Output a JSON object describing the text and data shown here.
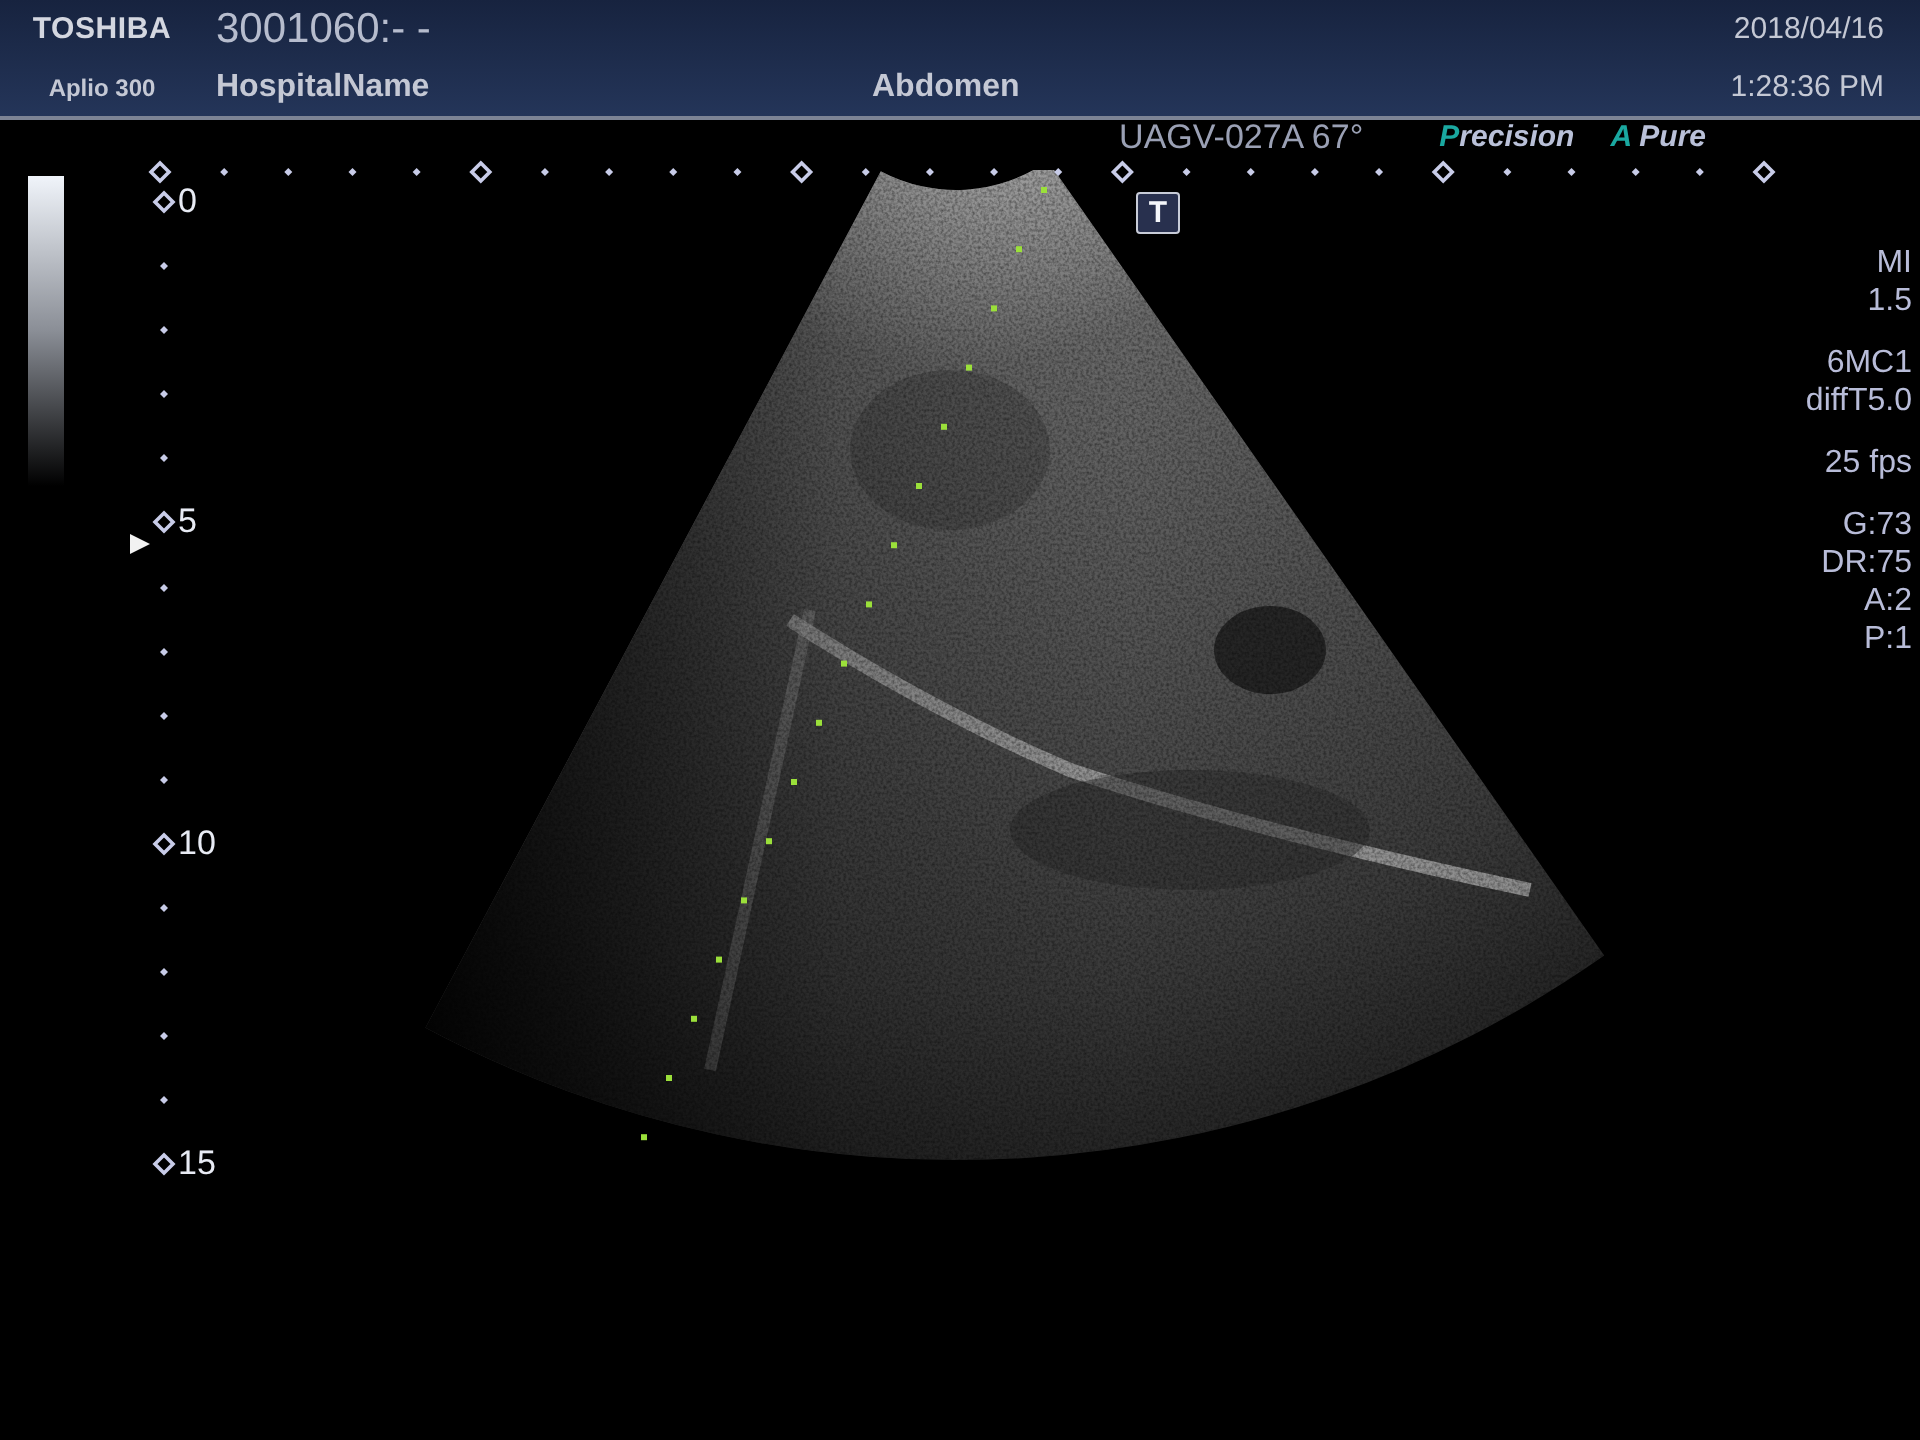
{
  "header": {
    "brand": "TOSHIBA",
    "model": "Aplio 300",
    "patient_id": "3001060:- -",
    "hospital": "HospitalName",
    "exam": "Abdomen",
    "date": "2018/04/16",
    "time": "1:28:36 PM"
  },
  "probe_info": {
    "probe": "UAGV-027A 67°",
    "precision": "Precision",
    "apure": "A Pure",
    "transducer_mark": "T"
  },
  "depth_ticks": [
    {
      "kind": "major",
      "label": "0",
      "focus": false
    },
    {
      "kind": "minor",
      "focus": false
    },
    {
      "kind": "minor",
      "focus": false
    },
    {
      "kind": "minor",
      "focus": false
    },
    {
      "kind": "minor",
      "focus": false
    },
    {
      "kind": "major",
      "label": "5",
      "focus": true
    },
    {
      "kind": "minor",
      "focus": false
    },
    {
      "kind": "minor",
      "focus": false
    },
    {
      "kind": "minor",
      "focus": false
    },
    {
      "kind": "minor",
      "focus": false
    },
    {
      "kind": "major",
      "label": "10",
      "focus": false
    },
    {
      "kind": "minor",
      "focus": false
    },
    {
      "kind": "minor",
      "focus": false
    },
    {
      "kind": "minor",
      "focus": false
    },
    {
      "kind": "minor",
      "focus": false
    },
    {
      "kind": "major",
      "label": "15",
      "focus": false
    }
  ],
  "parameters": [
    [
      "MI",
      "1.5"
    ],
    [
      "6MC1",
      "diffT5.0"
    ],
    [
      "25 fps"
    ],
    [
      "G:73",
      "DR:75",
      "A:2",
      "P:1"
    ]
  ]
}
